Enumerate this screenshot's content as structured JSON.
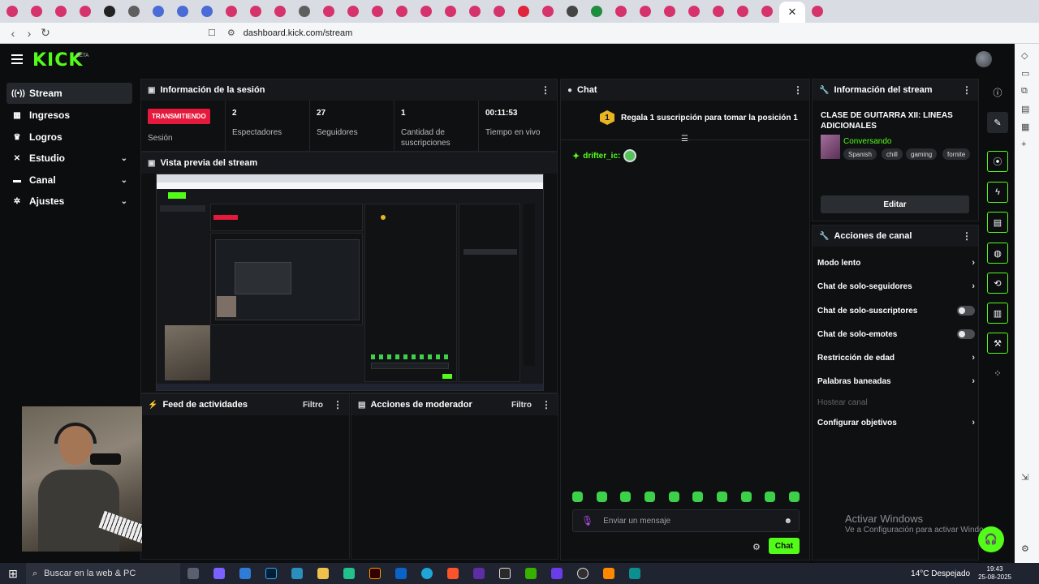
{
  "browser": {
    "url": "dashboard.kick.com/stream",
    "favicon_colors": [
      "#d6336c",
      "#d6336c",
      "#d6336c",
      "#d6336c",
      "#222222",
      "#5f5f5f",
      "#4b6bd6",
      "#4b6bd6",
      "#4b6bd6",
      "#d6336c",
      "#d6336c",
      "#d6336c",
      "#5f5f5f",
      "#d6336c",
      "#d6336c",
      "#d6336c",
      "#d6336c",
      "#d6336c",
      "#d6336c",
      "#d6336c",
      "#d6336c",
      "#e0243c",
      "#d6336c",
      "#444444",
      "#1e8e3e",
      "#d6336c",
      "#d6336c",
      "#d6336c",
      "#d6336c",
      "#d6336c",
      "#d6336c",
      "#d6336c",
      "#d6336c"
    ]
  },
  "header": {
    "logo": "KICK",
    "beta": "BETA"
  },
  "sidebar": {
    "items": [
      {
        "label": "Stream",
        "icon": "stream-icon"
      },
      {
        "label": "Ingresos",
        "icon": "revenue-icon"
      },
      {
        "label": "Logros",
        "icon": "trophy-icon"
      },
      {
        "label": "Estudio",
        "icon": "studio-icon"
      },
      {
        "label": "Canal",
        "icon": "channel-icon"
      },
      {
        "label": "Ajustes",
        "icon": "gear-icon"
      }
    ]
  },
  "session": {
    "title": "Información de la sesión",
    "live_badge": "TRANSMITIENDO",
    "live_label": "Sesión",
    "viewers_value": "2",
    "viewers_label": "Espectadores",
    "followers_value": "27",
    "followers_label": "Seguidores",
    "subs_value": "1",
    "subs_label": "Cantidad de suscripciones",
    "time_value": "00:11:53",
    "time_label": "Tiempo en vivo"
  },
  "preview": {
    "title": "Vista previa del stream"
  },
  "feed": {
    "title": "Feed de actividades",
    "filter": "Filtro"
  },
  "mod": {
    "title": "Acciones de moderador",
    "filter": "Filtro"
  },
  "chat": {
    "title": "Chat",
    "goal_number": "1",
    "goal_text": "Regala 1 suscripción para tomar la posición 1",
    "message_user": "drifter_ic:",
    "input_placeholder": "Enviar un mensaje",
    "send_label": "Chat",
    "emote_color": "#3dd14a"
  },
  "streaminfo": {
    "title": "Información del stream",
    "stream_title": "CLASE DE GUITARRA XII: LINEAS ADICIONALES",
    "category": "Conversando",
    "tags": [
      "Spanish",
      "chill",
      "gaming",
      "fornite"
    ],
    "edit_label": "Editar"
  },
  "channel_actions": {
    "title": "Acciones de canal",
    "items": [
      {
        "label": "Modo lento",
        "kind": "chevron"
      },
      {
        "label": "Chat de solo-seguidores",
        "kind": "chevron"
      },
      {
        "label": "Chat de solo-suscriptores",
        "kind": "toggle",
        "on": false
      },
      {
        "label": "Chat de solo-emotes",
        "kind": "toggle",
        "on": false
      },
      {
        "label": "Restricción de edad",
        "kind": "chevron"
      },
      {
        "label": "Palabras baneadas",
        "kind": "chevron"
      },
      {
        "label": "Hostear canal",
        "kind": "disabled"
      },
      {
        "label": "Configurar objetivos",
        "kind": "chevron"
      }
    ]
  },
  "watermark": {
    "line1": "Activar Windows",
    "line2": "Ve a Configuración para activar Windo"
  },
  "taskbar": {
    "search_placeholder": "Buscar en la web & PC",
    "weather": "14°C  Despejado",
    "time": "19:43",
    "date": "25-08-2025"
  },
  "colors": {
    "accent": "#53fc18",
    "live": "#e5193c",
    "panel": "#0e1012"
  }
}
